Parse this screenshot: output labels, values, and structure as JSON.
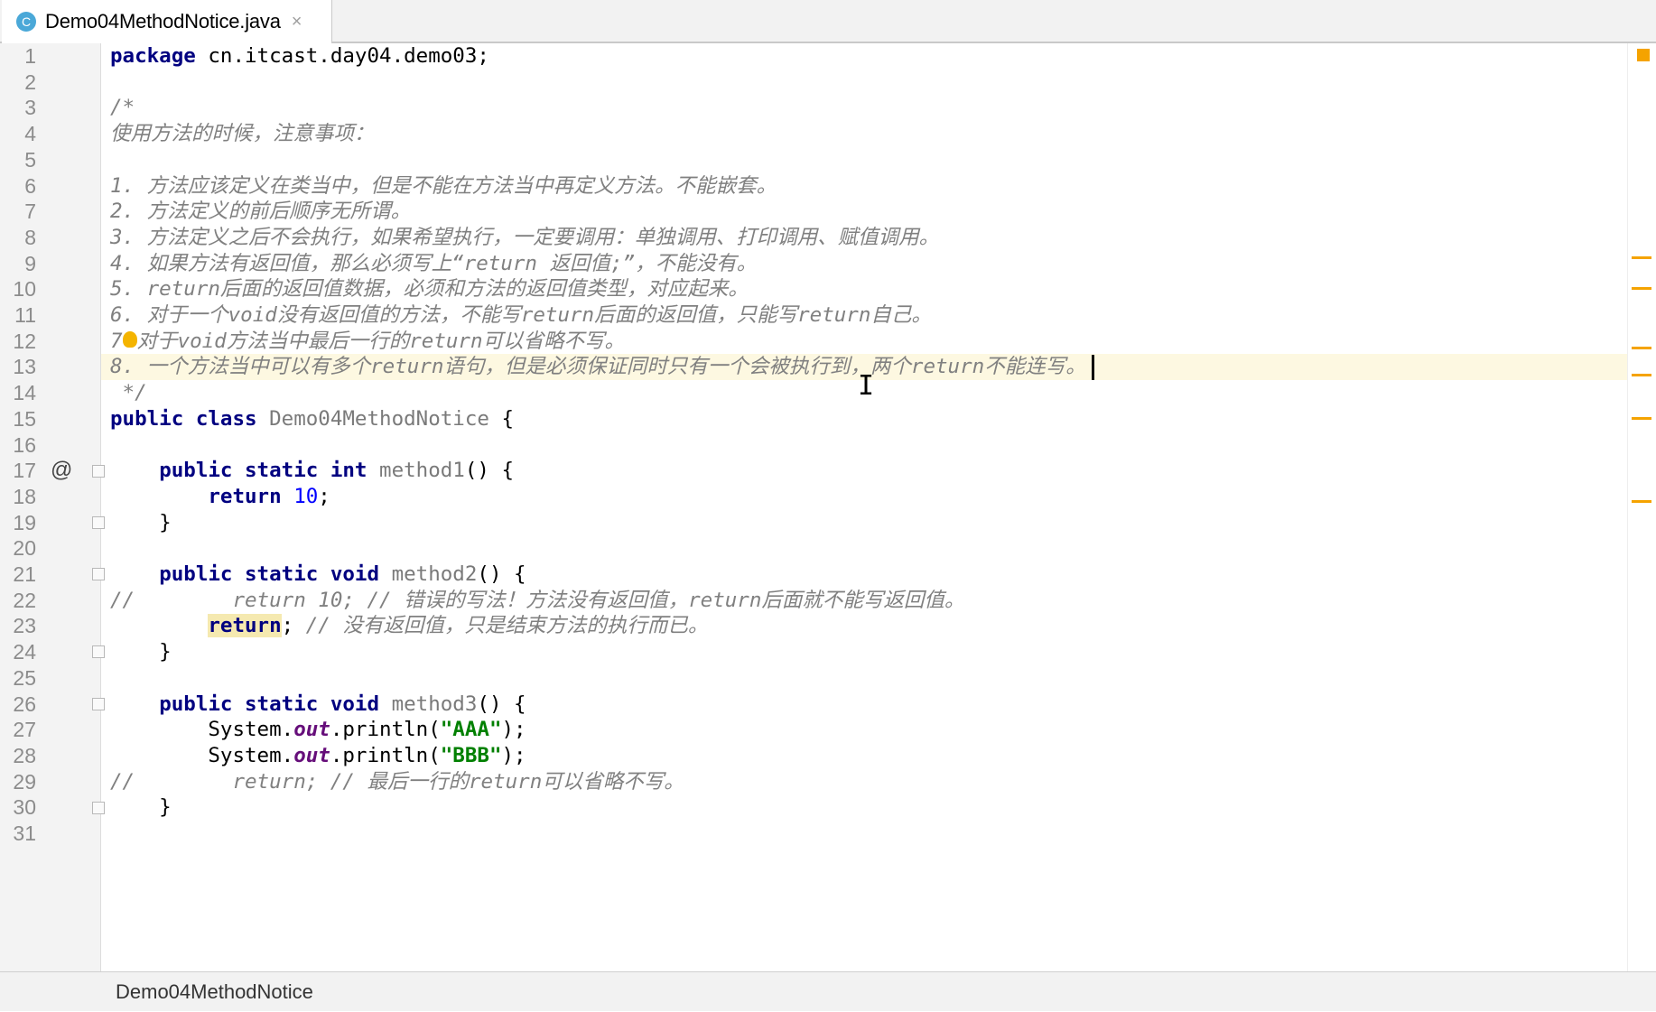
{
  "tab": {
    "icon_letter": "C",
    "filename": "Demo04MethodNotice.java",
    "close": "×"
  },
  "lines": [
    {
      "n": "1",
      "html": "<span class='kw'>package</span> cn.itcast.day04.demo03;"
    },
    {
      "n": "2",
      "html": ""
    },
    {
      "n": "3",
      "html": "<span class='cm'>/*</span>"
    },
    {
      "n": "4",
      "html": "<span class='cm'>使用方法的时候，注意事项：</span>"
    },
    {
      "n": "5",
      "html": ""
    },
    {
      "n": "6",
      "html": "<span class='cm'>1. 方法应该定义在类当中，但是不能在方法当中再定义方法。不能嵌套。</span>"
    },
    {
      "n": "7",
      "html": "<span class='cm'>2. 方法定义的前后顺序无所谓。</span>"
    },
    {
      "n": "8",
      "html": "<span class='cm'>3. 方法定义之后不会执行，如果希望执行，一定要调用：单独调用、打印调用、赋值调用。</span>"
    },
    {
      "n": "9",
      "html": "<span class='cm'>4. 如果方法有返回值，那么必须写上“return 返回值;”，不能没有。</span>"
    },
    {
      "n": "10",
      "html": "<span class='cm'>5. return后面的返回值数据，必须和方法的返回值类型，对应起来。</span>"
    },
    {
      "n": "11",
      "html": "<span class='cm'>6. 对于一个void没有返回值的方法，不能写return后面的返回值，只能写return自己。</span>"
    },
    {
      "n": "12",
      "html": "<span class='cm'>7<span class='bulb'></span>对于void方法当中最后一行的return可以省略不写。</span>"
    },
    {
      "n": "13",
      "html": "<span class='cm'>8. 一个方法当中可以有多个return语句，但是必须保证同时只有一个会被执行到，两个return不能连写。</span><span class='caret'></span>"
    },
    {
      "n": "14",
      "html": "<span class='cm'> */</span>"
    },
    {
      "n": "15",
      "html": "<span class='kw'>public class</span> <span class='mname'>Demo04MethodNotice</span> {"
    },
    {
      "n": "16",
      "html": ""
    },
    {
      "n": "17",
      "html": "    <span class='kw'>public static int</span> <span class='mname'>method1</span>() {"
    },
    {
      "n": "18",
      "html": "        <span class='kw'>return</span> <span class='num-lit'>10</span>;"
    },
    {
      "n": "19",
      "html": "    }"
    },
    {
      "n": "20",
      "html": ""
    },
    {
      "n": "21",
      "html": "    <span class='kw'>public static void</span> <span class='mname'>method2</span>() {"
    },
    {
      "n": "22",
      "html": "<span class='cm'>//        return 10; // 错误的写法！方法没有返回值，return后面就不能写返回值。</span>"
    },
    {
      "n": "23",
      "html": "        <span class='kw hl'>return</span>; <span class='cm'>// 没有返回值，只是结束方法的执行而已。</span>"
    },
    {
      "n": "24",
      "html": "    }"
    },
    {
      "n": "25",
      "html": ""
    },
    {
      "n": "26",
      "html": "    <span class='kw'>public static void</span> <span class='mname'>method3</span>() {"
    },
    {
      "n": "27",
      "html": "        System.<span class='field'>out</span>.println(<span class='str'>\"AAA\"</span>);"
    },
    {
      "n": "28",
      "html": "        System.<span class='field'>out</span>.println(<span class='str'>\"BBB\"</span>);"
    },
    {
      "n": "29",
      "html": "<span class='cm'>//        return; // 最后一行的return可以省略不写。</span>"
    },
    {
      "n": "30",
      "html": "    }"
    },
    {
      "n": "31",
      "html": ""
    }
  ],
  "gutter_marks": {
    "17": "@"
  },
  "fold_lines": [
    "17",
    "19",
    "21",
    "24",
    "26",
    "30"
  ],
  "current_line": "13",
  "status": {
    "breadcrumb": "Demo04MethodNotice"
  },
  "colors": {
    "keyword": "#000080",
    "comment": "#808080",
    "string": "#008000",
    "number": "#0000ff",
    "warning": "#f5a300"
  }
}
